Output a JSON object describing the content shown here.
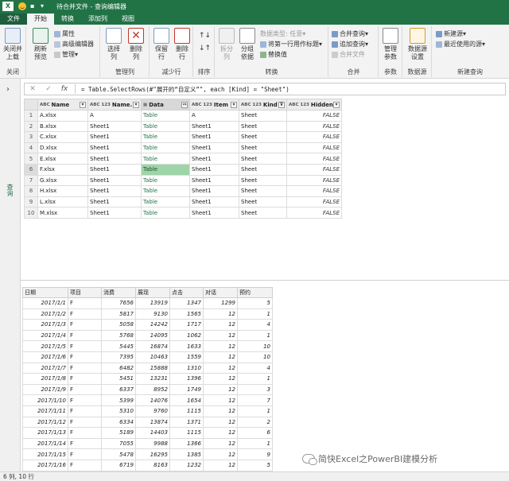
{
  "window": {
    "title": "待合并文件 - 查询编辑器",
    "logo_letter": "X"
  },
  "colors": {
    "brand": "#217346",
    "selected_cell": "#9ed5a8",
    "table_link": "#217346"
  },
  "tabs": [
    {
      "label": "文件"
    },
    {
      "label": "开始"
    },
    {
      "label": "转换"
    },
    {
      "label": "添加列"
    },
    {
      "label": "视图"
    }
  ],
  "ribbon": {
    "close": {
      "btn": "关闭并\n上载",
      "group": "关闭"
    },
    "query": {
      "refresh": "刷新\n预览",
      "properties": "属性",
      "advanced_editor": "高级编辑器",
      "manage": "管理"
    },
    "columns": {
      "choose": "选择\n列",
      "remove": "删除\n列",
      "group": "管理列"
    },
    "rows": {
      "keep": "保留\n行",
      "remove": "删除\n行",
      "group": "减少行"
    },
    "sort": {
      "group": "排序"
    },
    "transform": {
      "split": "拆分\n列",
      "groupby": "分组\n依据",
      "datatype": "数据类型: 任意",
      "first_row": "将第一行用作标题",
      "replace": "替换值",
      "group": "转换"
    },
    "combine": {
      "merge": "合并查询",
      "append": "追加查询",
      "combine_files": "合并文件",
      "group": "合并"
    },
    "params": {
      "manage": "管理\n参数",
      "group": "参数"
    },
    "datasource": {
      "settings": "数据源\n设置",
      "group": "数据源"
    },
    "newquery": {
      "new_source": "新建源",
      "recent": "最近使用的源",
      "group": "新建查询"
    }
  },
  "left_pane": {
    "label": "查询"
  },
  "formula": {
    "cancel": "✕",
    "confirm": "✓",
    "fx": "fx",
    "text": "= Table.SelectRows(#\"展开的“自定义”\", each [Kind] = \"Sheet\")"
  },
  "main_table": {
    "columns": [
      {
        "type": "ABC",
        "name": "Name"
      },
      {
        "type": "ABC 123",
        "name": "Name.1"
      },
      {
        "type": "Table",
        "name": "Data"
      },
      {
        "type": "ABC 123",
        "name": "Item"
      },
      {
        "type": "ABC 123",
        "name": "Kind"
      },
      {
        "type": "ABC 123",
        "name": "Hidden"
      }
    ],
    "rows": [
      {
        "n": "1",
        "name": "A.xlsx",
        "name1": "A",
        "data": "Table",
        "item": "A",
        "kind": "Sheet",
        "hidden": "FALSE"
      },
      {
        "n": "2",
        "name": "B.xlsx",
        "name1": "Sheet1",
        "data": "Table",
        "item": "Sheet1",
        "kind": "Sheet",
        "hidden": "FALSE"
      },
      {
        "n": "3",
        "name": "C.xlsx",
        "name1": "Sheet1",
        "data": "Table",
        "item": "Sheet1",
        "kind": "Sheet",
        "hidden": "FALSE"
      },
      {
        "n": "4",
        "name": "D.xlsx",
        "name1": "Sheet1",
        "data": "Table",
        "item": "Sheet1",
        "kind": "Sheet",
        "hidden": "FALSE"
      },
      {
        "n": "5",
        "name": "E.xlsx",
        "name1": "Sheet1",
        "data": "Table",
        "item": "Sheet1",
        "kind": "Sheet",
        "hidden": "FALSE"
      },
      {
        "n": "6",
        "name": "F.xlsx",
        "name1": "Sheet1",
        "data": "Table",
        "item": "Sheet1",
        "kind": "Sheet",
        "hidden": "FALSE"
      },
      {
        "n": "7",
        "name": "G.xlsx",
        "name1": "Sheet1",
        "data": "Table",
        "item": "Sheet1",
        "kind": "Sheet",
        "hidden": "FALSE"
      },
      {
        "n": "8",
        "name": "H.xlsx",
        "name1": "Sheet1",
        "data": "Table",
        "item": "Sheet1",
        "kind": "Sheet",
        "hidden": "FALSE"
      },
      {
        "n": "9",
        "name": "L.xlsx",
        "name1": "Sheet1",
        "data": "Table",
        "item": "Sheet1",
        "kind": "Sheet",
        "hidden": "FALSE"
      },
      {
        "n": "10",
        "name": "M.xlsx",
        "name1": "Sheet1",
        "data": "Table",
        "item": "Sheet1",
        "kind": "Sheet",
        "hidden": "FALSE"
      }
    ],
    "selected_row": 6
  },
  "preview_table": {
    "columns": [
      "日期",
      "项目",
      "消费",
      "展现",
      "点击",
      "对话",
      "预约"
    ],
    "rows": [
      [
        "2017/1/1",
        "F",
        "7656",
        "13919",
        "1347",
        "1299",
        "5"
      ],
      [
        "2017/1/2",
        "F",
        "5817",
        "9130",
        "1565",
        "12",
        "1"
      ],
      [
        "2017/1/3",
        "F",
        "5058",
        "14242",
        "1717",
        "12",
        "4"
      ],
      [
        "2017/1/4",
        "F",
        "5768",
        "14095",
        "1062",
        "12",
        "1"
      ],
      [
        "2017/1/5",
        "F",
        "5445",
        "16874",
        "1633",
        "12",
        "10"
      ],
      [
        "2017/1/6",
        "F",
        "7395",
        "10463",
        "1559",
        "12",
        "10"
      ],
      [
        "2017/1/7",
        "F",
        "6482",
        "15888",
        "1310",
        "12",
        "4"
      ],
      [
        "2017/1/8",
        "F",
        "5451",
        "13231",
        "1396",
        "12",
        "1"
      ],
      [
        "2017/1/9",
        "F",
        "6337",
        "8952",
        "1749",
        "12",
        "3"
      ],
      [
        "2017/1/10",
        "F",
        "5399",
        "14076",
        "1654",
        "12",
        "7"
      ],
      [
        "2017/1/11",
        "F",
        "5310",
        "9760",
        "1115",
        "12",
        "1"
      ],
      [
        "2017/1/12",
        "F",
        "6334",
        "13874",
        "1371",
        "12",
        "2"
      ],
      [
        "2017/1/13",
        "F",
        "5189",
        "14403",
        "1115",
        "12",
        "6"
      ],
      [
        "2017/1/14",
        "F",
        "7055",
        "9988",
        "1366",
        "12",
        "1"
      ],
      [
        "2017/1/15",
        "F",
        "5478",
        "16295",
        "1385",
        "12",
        "9"
      ],
      [
        "2017/1/16",
        "F",
        "6719",
        "8163",
        "1232",
        "12",
        "5"
      ]
    ]
  },
  "status": {
    "text": "6 列, 10 行"
  },
  "watermark": {
    "text": "简快Excel之PowerBI建模分析"
  }
}
